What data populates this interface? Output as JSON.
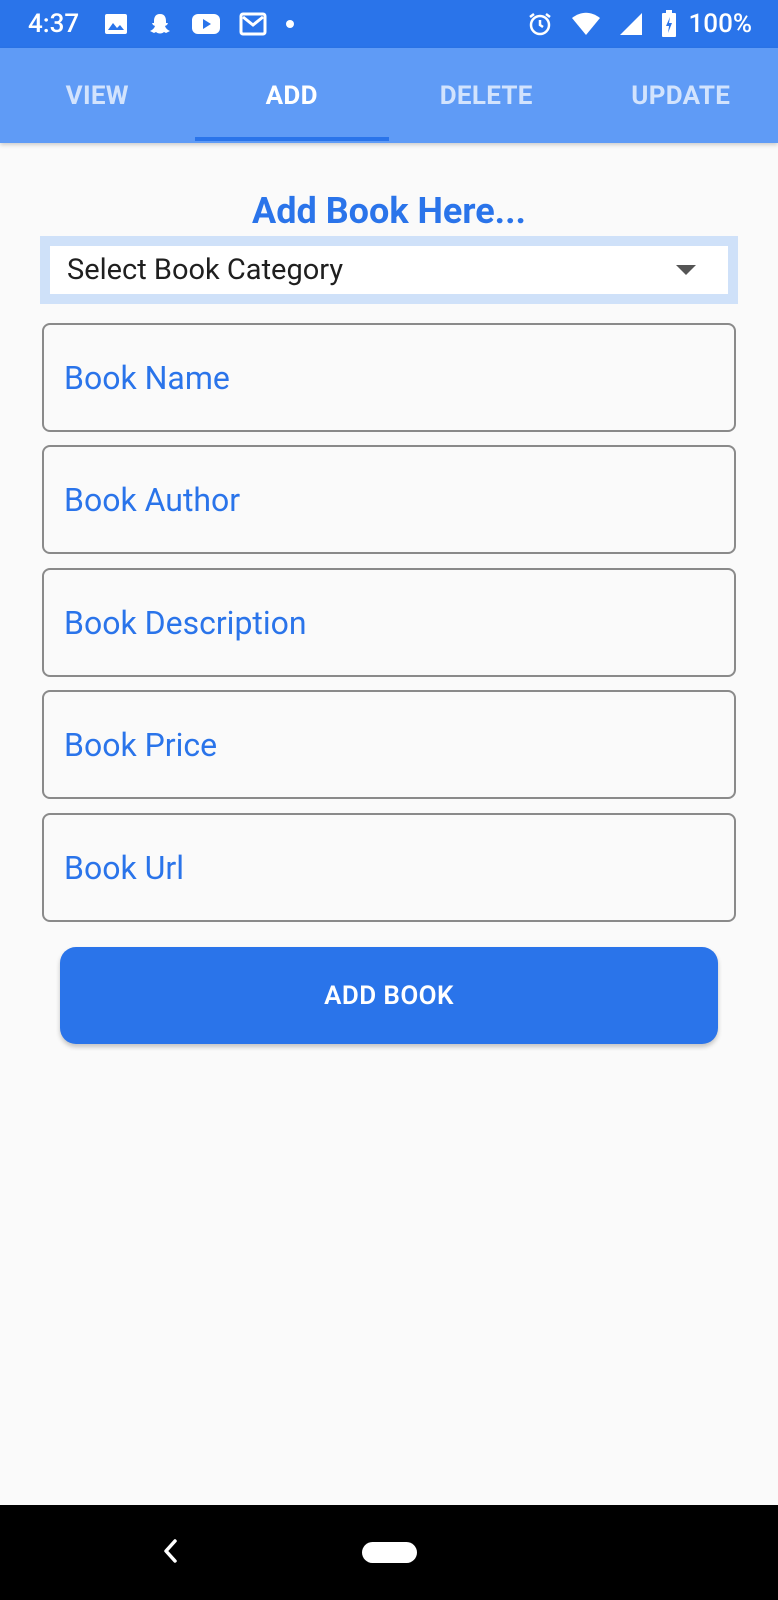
{
  "status_bar": {
    "time": "4:37",
    "battery_text": "100%",
    "left_icons": [
      "image-icon",
      "snapchat-icon",
      "youtube-icon",
      "gmail-icon",
      "notification-dot-icon"
    ],
    "right_icons": [
      "alarm-icon",
      "wifi-icon",
      "signal-icon",
      "battery-charging-icon"
    ]
  },
  "tabs": [
    {
      "label": "VIEW",
      "active": false
    },
    {
      "label": "ADD",
      "active": true
    },
    {
      "label": "DELETE",
      "active": false
    },
    {
      "label": "UPDATE",
      "active": false
    }
  ],
  "form": {
    "title": "Add Book Here...",
    "category_placeholder": "Select Book Category",
    "fields": {
      "name_placeholder": "Book Name",
      "author_placeholder": "Book Author",
      "description_placeholder": "Book Description",
      "price_placeholder": "Book Price",
      "url_placeholder": "Book Url"
    },
    "submit_label": "ADD BOOK"
  },
  "colors": {
    "status_bar": "#2a74ea",
    "tab_bar": "#5f9bf6",
    "accent": "#2a74ea",
    "background": "#fafafa"
  }
}
